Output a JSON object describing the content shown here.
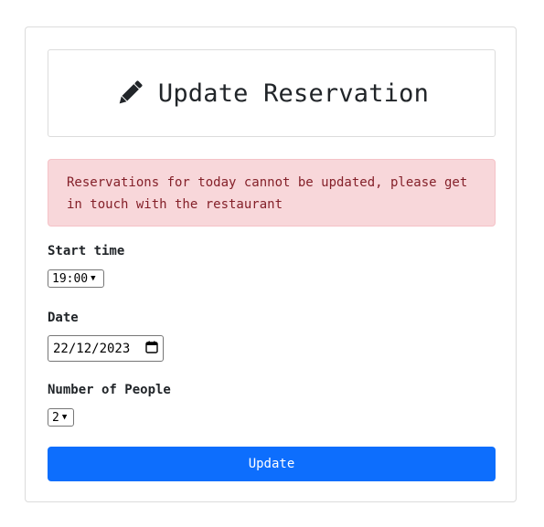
{
  "header": {
    "icon": "pencil-icon",
    "title": "Update Reservation"
  },
  "alert": {
    "message": "Reservations for today cannot be updated, please get in touch with the restaurant",
    "background_color": "#f8d7da",
    "text_color": "#842029"
  },
  "form": {
    "start_time": {
      "label": "Start time",
      "value": "19:00"
    },
    "date": {
      "label": "Date",
      "value": "22/12/2023"
    },
    "people": {
      "label": "Number of People",
      "value": "2"
    },
    "submit_label": "Update",
    "submit_color": "#0d6efd"
  }
}
